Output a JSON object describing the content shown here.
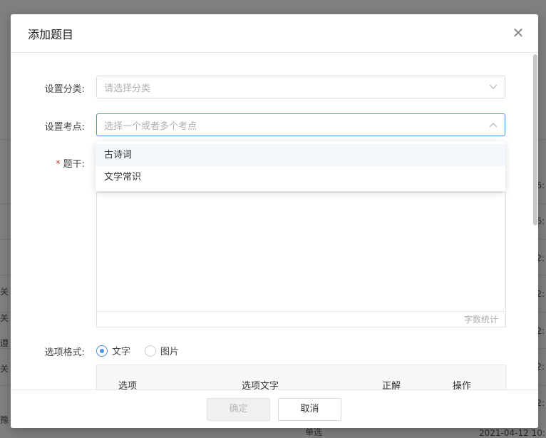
{
  "background": {
    "right_cells": [
      "6:",
      "6:",
      "2:",
      "2:",
      "2:",
      "2:",
      "2:",
      "2:"
    ],
    "left_cells": [
      "关",
      "关",
      "遵",
      "关",
      "豫"
    ],
    "bottom_cells": [
      "单选",
      "2021-04-12 10:"
    ]
  },
  "dialog": {
    "title": "添加题目",
    "close_glyph": "✕"
  },
  "form": {
    "category": {
      "label": "设置分类:",
      "placeholder": "请选择分类"
    },
    "points": {
      "label": "设置考点:",
      "placeholder": "选择一个或者多个考点",
      "options": [
        "古诗词",
        "文学常识"
      ]
    },
    "stem": {
      "required_mark": "*",
      "label": "题干:",
      "word_count": "字数统计"
    },
    "option_format": {
      "label": "选项格式:",
      "choices": [
        {
          "label": "文字",
          "checked": true
        },
        {
          "label": "图片",
          "checked": false
        }
      ]
    },
    "options_table": {
      "headers": [
        "选项",
        "选项文字",
        "正解",
        "操作"
      ]
    }
  },
  "footer": {
    "confirm_label": "确定",
    "cancel_label": "取消"
  },
  "colors": {
    "accent": "#4a90e2",
    "required": "#e53935"
  }
}
